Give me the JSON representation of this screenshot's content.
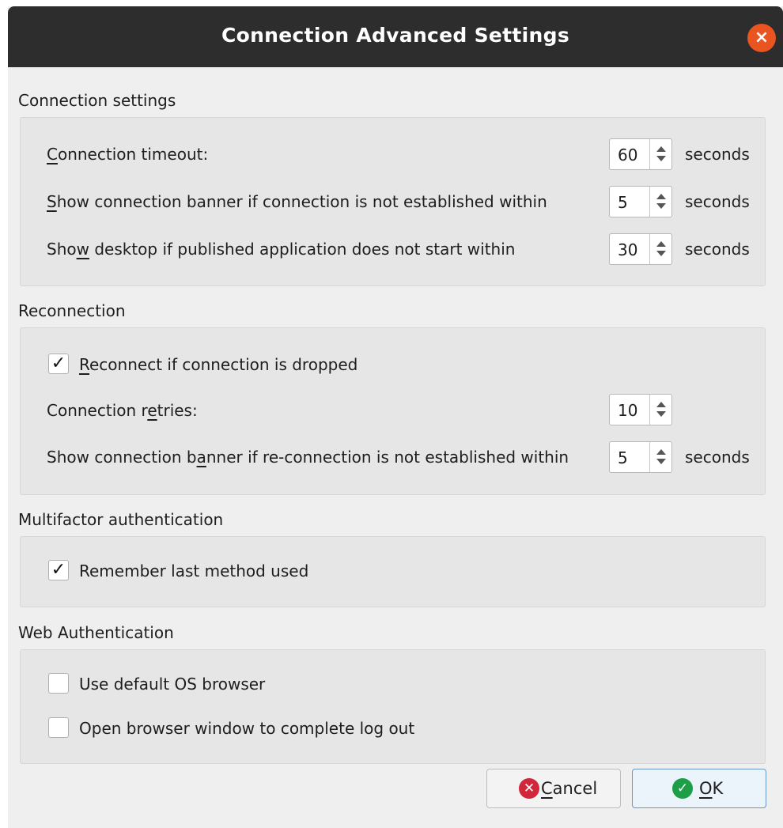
{
  "window": {
    "title": "Connection Advanced Settings"
  },
  "sections": {
    "connection": {
      "title": "Connection settings",
      "timeout": {
        "label": "Connection timeout:",
        "value": "60",
        "unit": "seconds"
      },
      "banner": {
        "label": "Show connection banner if connection is not established within",
        "value": "5",
        "unit": "seconds"
      },
      "desktop": {
        "label": "Show desktop if published application does not start within",
        "value": "30",
        "unit": "seconds"
      }
    },
    "reconnection": {
      "title": "Reconnection",
      "reconnect": {
        "label": "Reconnect if connection is dropped",
        "checked": true,
        "mark": "✓"
      },
      "retries": {
        "label": "Connection retries:",
        "value": "10"
      },
      "banner": {
        "label": "Show connection banner if re-connection is not established within",
        "value": "5",
        "unit": "seconds"
      }
    },
    "mfa": {
      "title": "Multifactor authentication",
      "remember": {
        "label": "Remember last method used",
        "checked": true,
        "mark": "✓"
      }
    },
    "web": {
      "title": "Web Authentication",
      "default_browser": {
        "label": "Use default OS browser",
        "checked": false
      },
      "logout_browser": {
        "label": "Open browser window to complete log out",
        "checked": false
      }
    }
  },
  "buttons": {
    "cancel": {
      "label": "Cancel",
      "icon": "cancel-icon",
      "color": "#d0273a"
    },
    "ok": {
      "label": "OK",
      "icon": "ok-icon",
      "color": "#1f9e48"
    }
  },
  "colors": {
    "titlebar": "#2d2d2d",
    "close": "#e95420",
    "accent": "#6b95c4"
  }
}
